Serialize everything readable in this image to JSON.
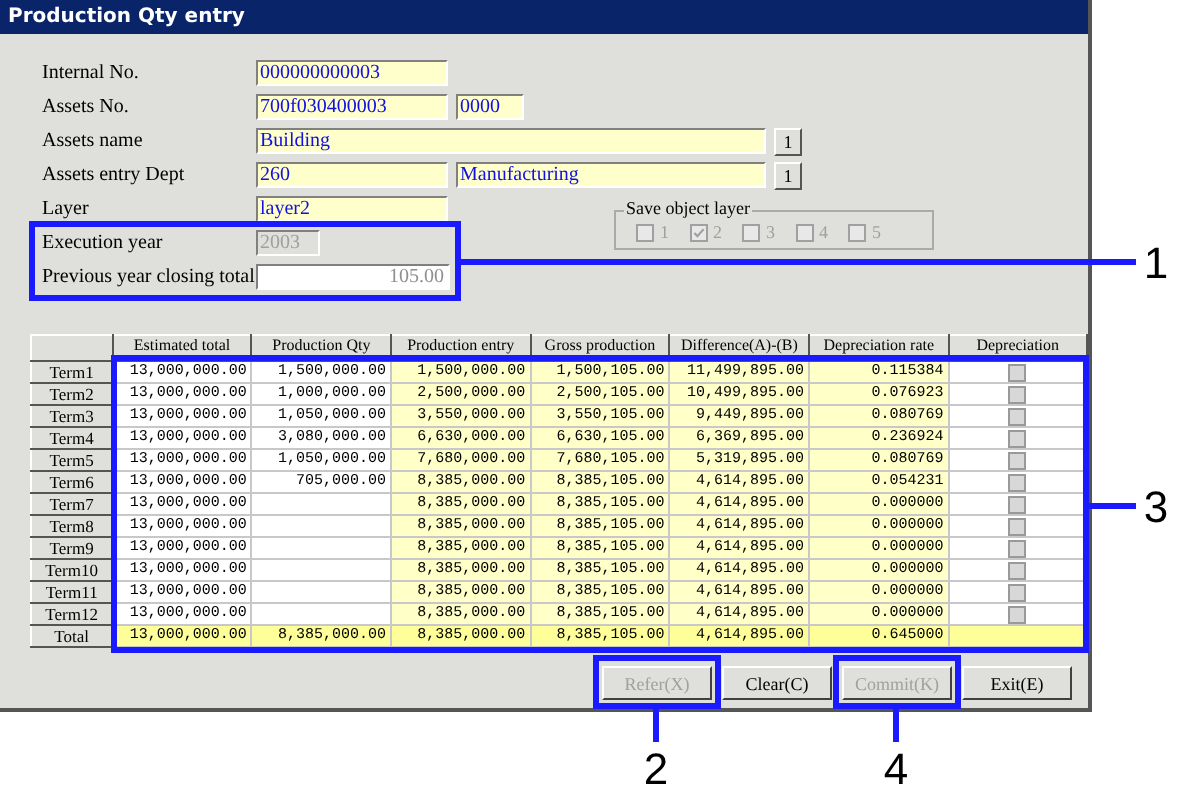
{
  "window": {
    "title": "Production Qty entry"
  },
  "fields": [
    {
      "label": "Internal No.",
      "kind": "entry",
      "values": [
        "000000000003"
      ]
    },
    {
      "label": "Assets No.",
      "kind": "entry",
      "values": [
        "700f030400003",
        "0000"
      ]
    },
    {
      "label": "Assets name",
      "kind": "entry",
      "values": [
        "Building"
      ],
      "lookup_button": "1"
    },
    {
      "label": "Assets entry Dept",
      "kind": "entry",
      "values": [
        "260",
        "Manufacturing"
      ],
      "lookup_button": "1"
    },
    {
      "label": "Layer",
      "kind": "entry",
      "values": [
        "layer2"
      ]
    },
    {
      "label": "Execution year",
      "kind": "disabled",
      "values": [
        "2003"
      ]
    },
    {
      "label": "Previous year closing total",
      "kind": "readonly",
      "values": [
        "105.00"
      ]
    }
  ],
  "save_object_layer": {
    "title": "Save object layer",
    "options": [
      {
        "label": "1",
        "checked": false
      },
      {
        "label": "2",
        "checked": true
      },
      {
        "label": "3",
        "checked": false
      },
      {
        "label": "4",
        "checked": false
      },
      {
        "label": "5",
        "checked": false
      }
    ]
  },
  "table": {
    "columns": [
      "Estimated total",
      "Production Qty",
      "Production entry",
      "Gross production",
      "Difference(A)-(B)",
      "Depreciation rate",
      "Depreciation"
    ],
    "rows": [
      {
        "term": "Term1",
        "cells": [
          "13,000,000.00",
          "1,500,000.00",
          "1,500,000.00",
          "1,500,105.00",
          "11,499,895.00",
          "0.115384"
        ]
      },
      {
        "term": "Term2",
        "cells": [
          "13,000,000.00",
          "1,000,000.00",
          "2,500,000.00",
          "2,500,105.00",
          "10,499,895.00",
          "0.076923"
        ]
      },
      {
        "term": "Term3",
        "cells": [
          "13,000,000.00",
          "1,050,000.00",
          "3,550,000.00",
          "3,550,105.00",
          "9,449,895.00",
          "0.080769"
        ]
      },
      {
        "term": "Term4",
        "cells": [
          "13,000,000.00",
          "3,080,000.00",
          "6,630,000.00",
          "6,630,105.00",
          "6,369,895.00",
          "0.236924"
        ]
      },
      {
        "term": "Term5",
        "cells": [
          "13,000,000.00",
          "1,050,000.00",
          "7,680,000.00",
          "7,680,105.00",
          "5,319,895.00",
          "0.080769"
        ]
      },
      {
        "term": "Term6",
        "cells": [
          "13,000,000.00",
          "705,000.00",
          "8,385,000.00",
          "8,385,105.00",
          "4,614,895.00",
          "0.054231"
        ]
      },
      {
        "term": "Term7",
        "cells": [
          "13,000,000.00",
          "",
          "8,385,000.00",
          "8,385,105.00",
          "4,614,895.00",
          "0.000000"
        ]
      },
      {
        "term": "Term8",
        "cells": [
          "13,000,000.00",
          "",
          "8,385,000.00",
          "8,385,105.00",
          "4,614,895.00",
          "0.000000"
        ]
      },
      {
        "term": "Term9",
        "cells": [
          "13,000,000.00",
          "",
          "8,385,000.00",
          "8,385,105.00",
          "4,614,895.00",
          "0.000000"
        ]
      },
      {
        "term": "Term10",
        "cells": [
          "13,000,000.00",
          "",
          "8,385,000.00",
          "8,385,105.00",
          "4,614,895.00",
          "0.000000"
        ]
      },
      {
        "term": "Term11",
        "cells": [
          "13,000,000.00",
          "",
          "8,385,000.00",
          "8,385,105.00",
          "4,614,895.00",
          "0.000000"
        ]
      },
      {
        "term": "Term12",
        "cells": [
          "13,000,000.00",
          "",
          "8,385,000.00",
          "8,385,105.00",
          "4,614,895.00",
          "0.000000"
        ]
      }
    ],
    "total": {
      "term": "Total",
      "cells": [
        "13,000,000.00",
        "8,385,000.00",
        "8,385,000.00",
        "8,385,105.00",
        "4,614,895.00",
        "0.645000"
      ]
    }
  },
  "buttons": [
    {
      "label": "Refer(X)",
      "disabled": true
    },
    {
      "label": "Clear(C)",
      "disabled": false
    },
    {
      "label": "Commit(K)",
      "disabled": true
    },
    {
      "label": "Exit(E)",
      "disabled": false
    }
  ],
  "callouts": [
    {
      "number": "1"
    },
    {
      "number": "2"
    },
    {
      "number": "3"
    },
    {
      "number": "4"
    }
  ]
}
